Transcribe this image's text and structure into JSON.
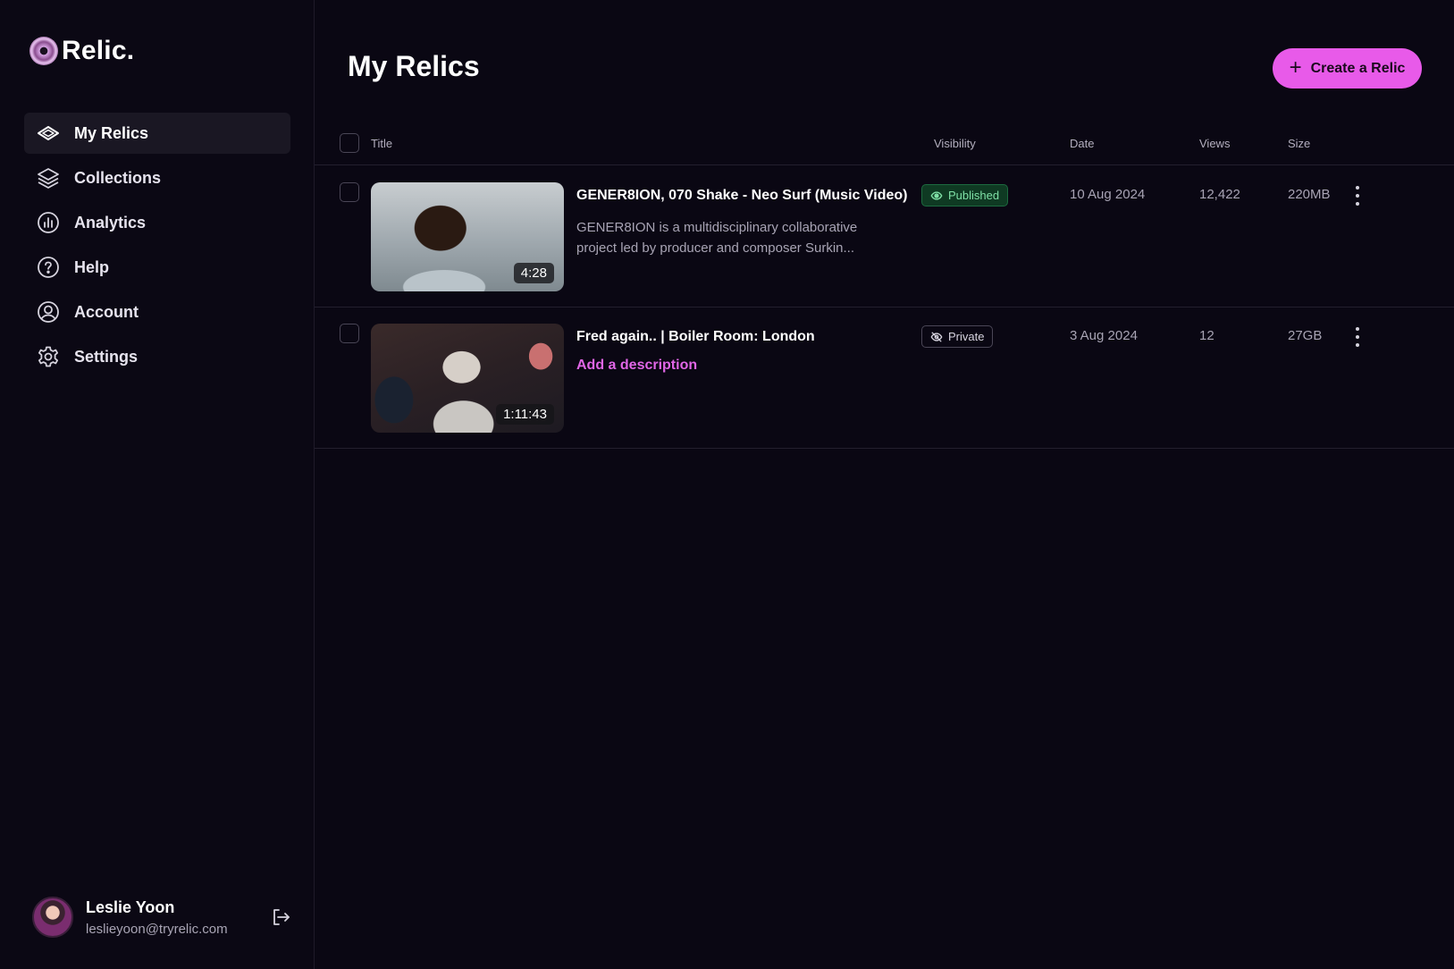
{
  "app": {
    "name": "Relic."
  },
  "sidebar": {
    "items": [
      {
        "label": "My Relics",
        "icon": "diamond-icon",
        "active": true
      },
      {
        "label": "Collections",
        "icon": "layers-icon",
        "active": false
      },
      {
        "label": "Analytics",
        "icon": "chart-icon",
        "active": false
      },
      {
        "label": "Help",
        "icon": "help-icon",
        "active": false
      },
      {
        "label": "Account",
        "icon": "user-circle-icon",
        "active": false
      },
      {
        "label": "Settings",
        "icon": "gear-icon",
        "active": false
      }
    ]
  },
  "user": {
    "name": "Leslie Yoon",
    "email": "leslieyoon@tryrelic.com"
  },
  "main": {
    "title": "My Relics",
    "create_label": "Create a Relic",
    "columns": {
      "title": "Title",
      "visibility": "Visibility",
      "date": "Date",
      "views": "Views",
      "size": "Size"
    },
    "rows": [
      {
        "title": "GENER8ION, 070 Shake - Neo Surf (Music Video)",
        "description": "GENER8ION is a multidisciplinary collaborative project led by producer and composer Surkin...",
        "duration": "4:28",
        "visibility": "Published",
        "date": "10 Aug 2024",
        "views": "12,422",
        "size": "220MB"
      },
      {
        "title": "Fred again.. | Boiler Room: London",
        "add_description": "Add a description",
        "duration": "1:11:43",
        "visibility": "Private",
        "date": "3 Aug 2024",
        "views": "12",
        "size": "27GB"
      }
    ]
  },
  "colors": {
    "accent": "#e85ae9",
    "background": "#0a0713",
    "published": "#7fe0a6"
  }
}
